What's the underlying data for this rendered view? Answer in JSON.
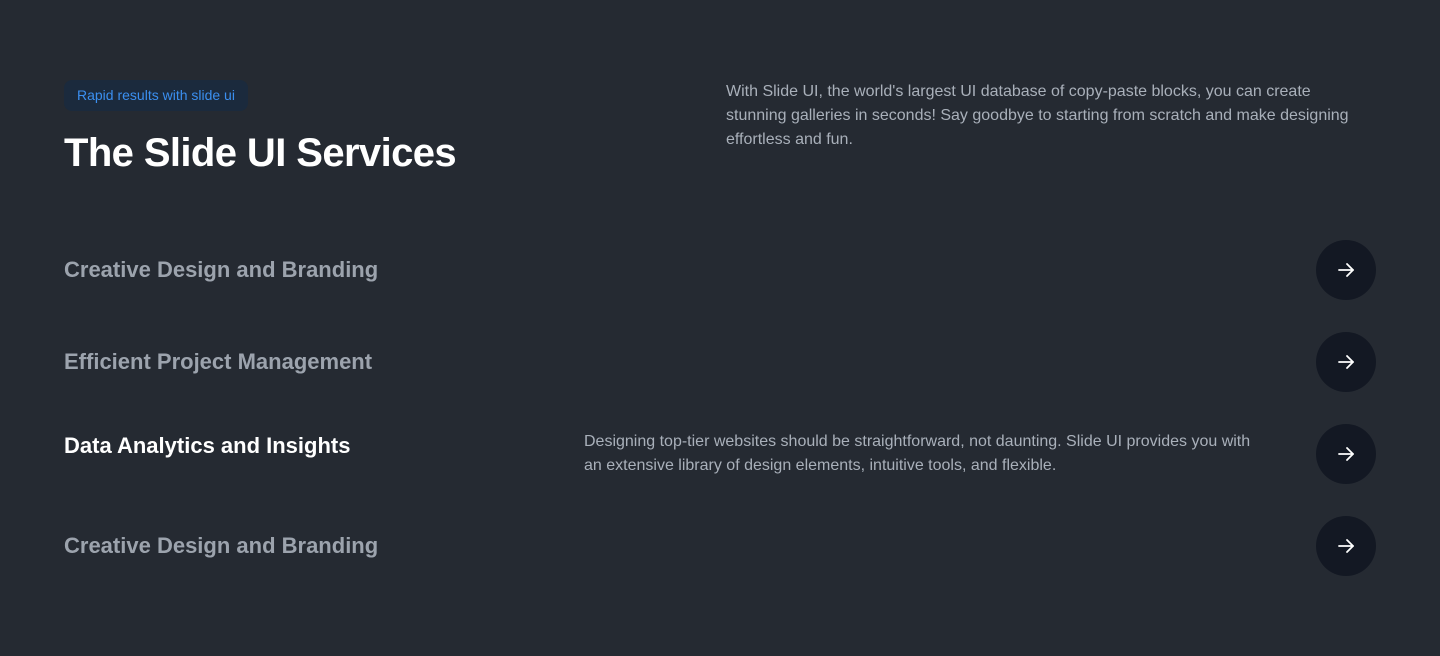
{
  "header": {
    "badge": "Rapid results with slide ui",
    "title": "The Slide UI Services",
    "intro": "With Slide UI, the world's largest UI database of copy-paste blocks, you can create stunning galleries in seconds! Say goodbye to starting from scratch and make designing effortless and fun."
  },
  "services": [
    {
      "title": "Creative Design and Branding",
      "description": "",
      "active": false,
      "button_icon": "arrow-right-icon"
    },
    {
      "title": "Efficient Project Management",
      "description": "",
      "active": false,
      "button_icon": "arrow-right-icon"
    },
    {
      "title": "Data Analytics and Insights",
      "description": "Designing top-tier websites should be straightforward, not daunting. Slide UI provides you with an extensive library of design elements, intuitive tools, and flexible.",
      "active": true,
      "button_icon": "arrow-right-icon"
    },
    {
      "title": "Creative Design and Branding",
      "description": "",
      "active": false,
      "button_icon": "arrow-right-icon"
    }
  ],
  "colors": {
    "background": "#252a32",
    "badge_background": "#1b2a3d",
    "badge_text": "#3b8ff0",
    "title_text": "#ffffff",
    "muted_text": "#9ca3ad",
    "body_text": "#a9b0ba",
    "button_background": "#131823"
  }
}
